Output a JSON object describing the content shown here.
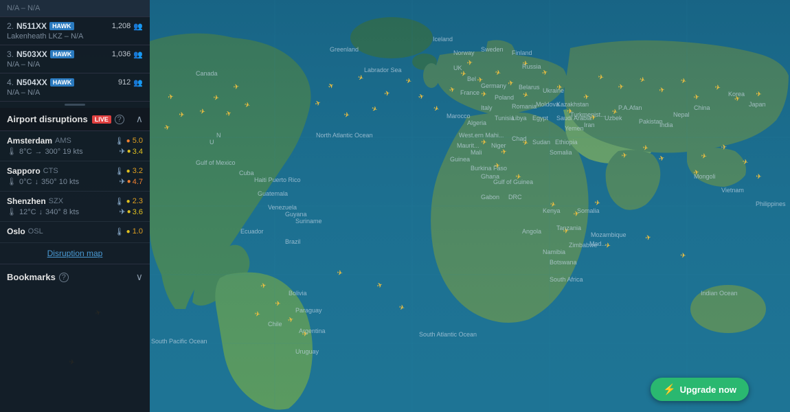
{
  "map": {
    "background": "#1a6b8a"
  },
  "sidebar": {
    "flights": [
      {
        "rank": "2.",
        "id": "N511XX",
        "badge": "HAWK",
        "count": "1,208",
        "route": "Lakenheath  LKZ – N/A"
      },
      {
        "rank": "3.",
        "id": "N503XX",
        "badge": "HAWK",
        "count": "1,036",
        "route": "N/A – N/A"
      },
      {
        "rank": "4.",
        "id": "N504XX",
        "badge": "HAWK",
        "count": "912",
        "route": "N/A – N/A"
      }
    ],
    "disruptions": {
      "title": "Airport disruptions",
      "live_badge": "LIVE",
      "items": [
        {
          "name": "Amsterdam",
          "code": "AMS",
          "score1_label": "5.0",
          "weather_icon": "🌡",
          "temp": "8°C",
          "wind_dir": "→",
          "wind": "300° 19 kts",
          "score2_label": "3.4",
          "score2_icon": "✈"
        },
        {
          "name": "Sapporo",
          "code": "CTS",
          "score1_label": "3.2",
          "weather_icon": "🌡",
          "temp": "0°C",
          "wind_dir": "↓",
          "wind": "350° 10 kts",
          "score2_label": "4.7",
          "score2_icon": "✈"
        },
        {
          "name": "Shenzhen",
          "code": "SZX",
          "score1_label": "2.3",
          "weather_icon": "🌡",
          "temp": "12°C",
          "wind_dir": "↓",
          "wind": "340° 8 kts",
          "score2_label": "3.6",
          "score2_icon": "✈"
        },
        {
          "name": "Oslo",
          "code": "OSL",
          "score1_label": "1.0",
          "weather_icon": "🌡",
          "temp": "",
          "wind_dir": "",
          "wind": "",
          "score2_label": "",
          "score2_icon": ""
        }
      ],
      "map_link": "Disruption map"
    },
    "bookmarks": {
      "title": "Bookmarks",
      "collapse_icon": "∨"
    }
  },
  "upgrade": {
    "label": "Upgrade now",
    "icon": "⚡"
  }
}
